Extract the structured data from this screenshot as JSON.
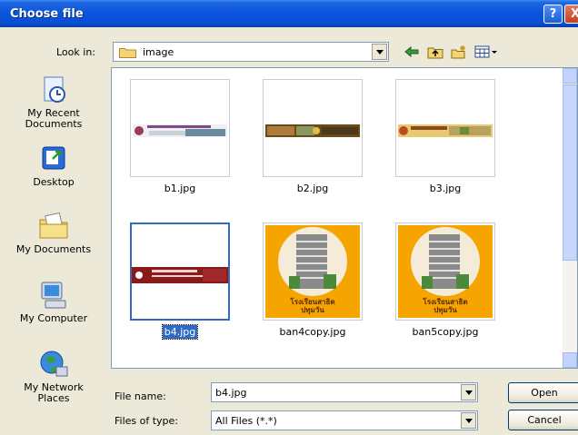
{
  "window": {
    "title": "Choose file",
    "help_glyph": "?",
    "close_glyph": "X"
  },
  "lookin": {
    "label": "Look in:",
    "value": "image",
    "icon": "folder-icon"
  },
  "toolbar": [
    {
      "name": "back-icon"
    },
    {
      "name": "up-folder-icon"
    },
    {
      "name": "new-folder-icon"
    },
    {
      "name": "view-menu-icon"
    }
  ],
  "places": [
    {
      "label_line1": "My Recent",
      "label_line2": "Documents",
      "icon": "recent-documents-icon"
    },
    {
      "label_line1": "Desktop",
      "label_line2": "",
      "icon": "desktop-icon"
    },
    {
      "label_line1": "My Documents",
      "label_line2": "",
      "icon": "my-documents-icon"
    },
    {
      "label_line1": "My Computer",
      "label_line2": "",
      "icon": "my-computer-icon"
    },
    {
      "label_line1": "My Network",
      "label_line2": "Places",
      "icon": "network-places-icon"
    }
  ],
  "files": [
    {
      "name": "b1.jpg",
      "selected": false,
      "kind": "banner"
    },
    {
      "name": "b2.jpg",
      "selected": false,
      "kind": "banner"
    },
    {
      "name": "b3.jpg",
      "selected": false,
      "kind": "banner"
    },
    {
      "name": "b4.jpg",
      "selected": true,
      "kind": "banner"
    },
    {
      "name": "ban4copy.jpg",
      "selected": false,
      "kind": "poster"
    },
    {
      "name": "ban5copy.jpg",
      "selected": false,
      "kind": "poster"
    }
  ],
  "poster_text": {
    "line1": "โรงเรียนสาธิต",
    "line2": "ปทุมวัน"
  },
  "filename": {
    "label": "File name:",
    "value": "b4.jpg"
  },
  "filetype": {
    "label": "Files of type:",
    "value": "All Files (*.*)"
  },
  "buttons": {
    "open": "Open",
    "cancel": "Cancel"
  },
  "colors": {
    "titlebar": "#0a54dc",
    "selection": "#316ac5",
    "face": "#ece9d8"
  }
}
